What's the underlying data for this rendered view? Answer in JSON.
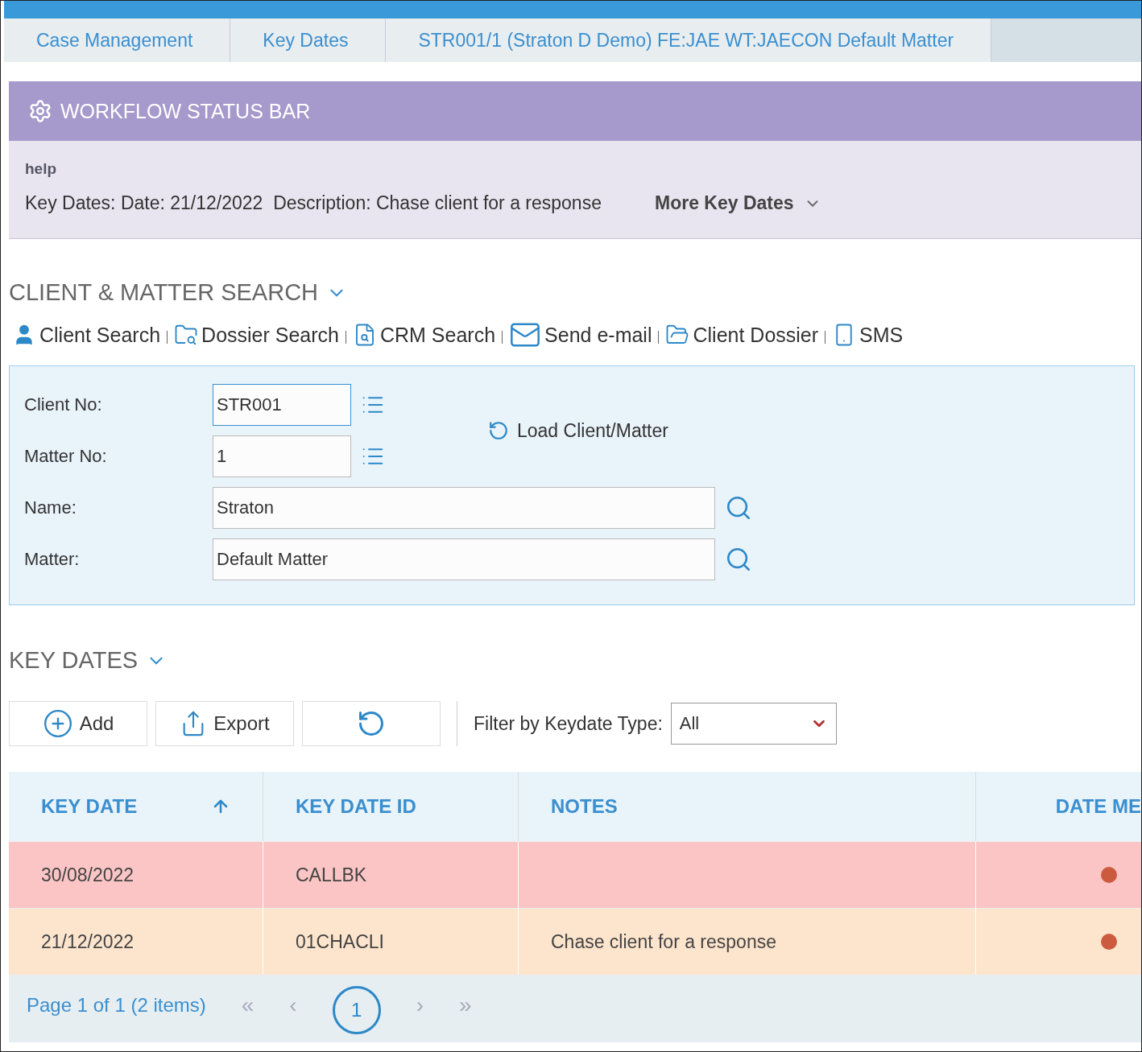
{
  "breadcrumbs": [
    {
      "label": "Case Management"
    },
    {
      "label": "Key Dates"
    },
    {
      "label": "STR001/1 (Straton D Demo) FE:JAE WT:JAECON Default Matter"
    }
  ],
  "workflow": {
    "title": "WORKFLOW STATUS BAR",
    "help": "help",
    "summary": "Key Dates: Date: 21/12/2022  Description: Chase client for a response",
    "more": "More Key Dates"
  },
  "client_search": {
    "title": "CLIENT & MATTER SEARCH",
    "links": [
      {
        "kind": "user",
        "label": "Client Search"
      },
      {
        "kind": "folder-search",
        "label": "Dossier Search"
      },
      {
        "kind": "file-search",
        "label": "CRM Search"
      },
      {
        "kind": "mail",
        "label": "Send e-mail"
      },
      {
        "kind": "folder-user",
        "label": "Client Dossier"
      },
      {
        "kind": "phone",
        "label": "SMS"
      }
    ],
    "fields": [
      {
        "kind": "short",
        "label": "Client No:",
        "value": "STR001",
        "focused": true
      },
      {
        "kind": "short",
        "label": "Matter No:",
        "value": "1",
        "focused": false
      },
      {
        "kind": "long",
        "label": "Name:",
        "value": "Straton",
        "focused": false
      },
      {
        "kind": "long",
        "label": "Matter:",
        "value": "Default Matter",
        "focused": false
      }
    ],
    "load": "Load Client/Matter"
  },
  "key_dates": {
    "title": "KEY DATES",
    "add": "Add",
    "export": "Export",
    "filter_label": "Filter by Keydate Type:",
    "filter_value": "All",
    "columns": [
      "KEY DATE",
      "KEY DATE ID",
      "NOTES",
      "DATE ME"
    ],
    "rows": [
      {
        "color": "#fcc5c5",
        "cells": [
          "30/08/2022",
          "CALLBK",
          ""
        ]
      },
      {
        "color": "#fde4cd",
        "cells": [
          "21/12/2022",
          "01CHACLI",
          "Chase client for a response"
        ]
      }
    ],
    "pager": {
      "summary": "Page 1 of 1 (2 items)",
      "first": "«",
      "prev": "‹",
      "pages": [
        {
          "label": "1",
          "selected": true
        }
      ],
      "next": "›",
      "last": "»"
    }
  }
}
